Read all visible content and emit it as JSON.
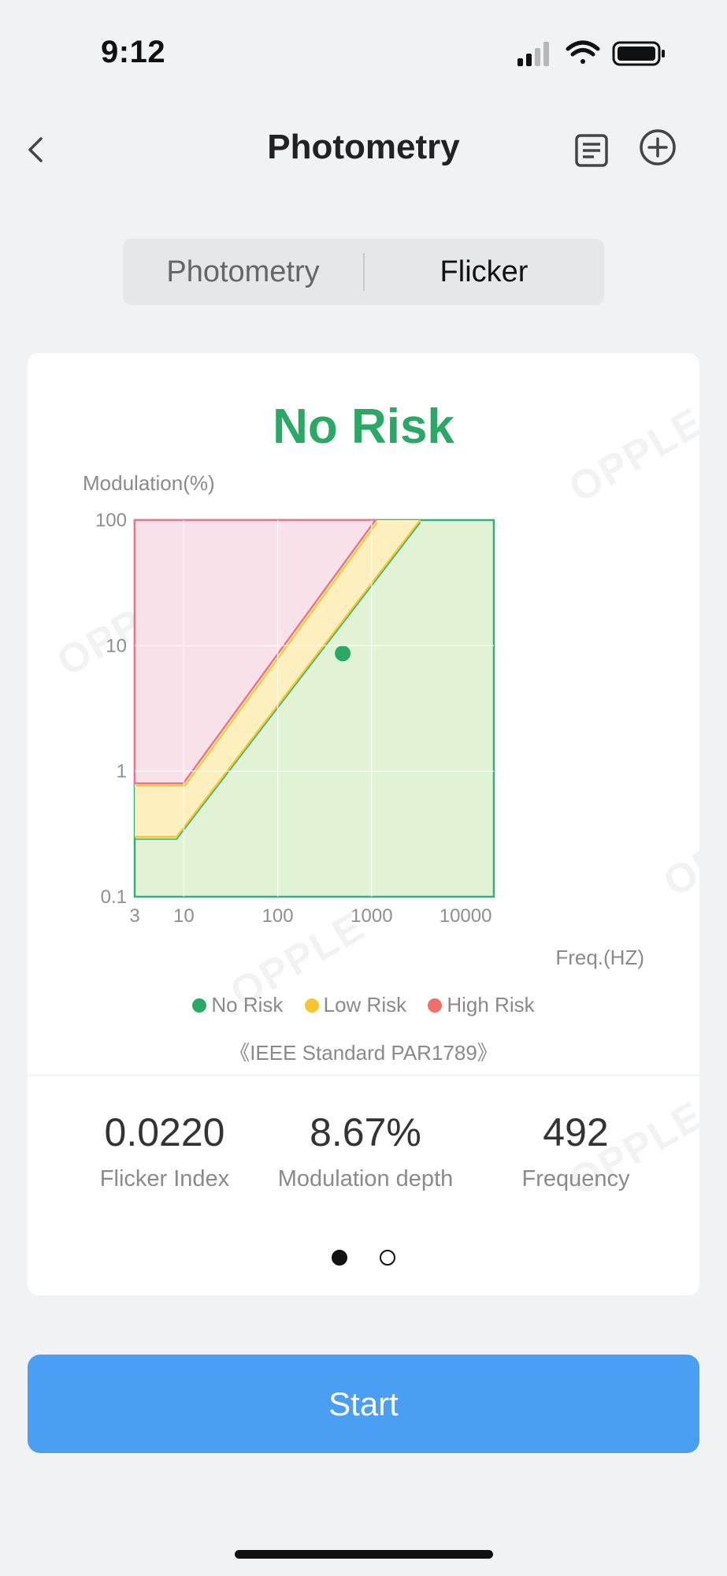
{
  "status_bar": {
    "time": "9:12",
    "icons": [
      "signal-icon",
      "wifi-icon",
      "battery-icon"
    ]
  },
  "nav": {
    "title": "Photometry",
    "back_icon": "chevron-left-icon",
    "doc_icon": "document-icon",
    "add_icon": "plus-circle-icon"
  },
  "tabs": [
    {
      "label": "Photometry",
      "selected": false
    },
    {
      "label": "Flicker",
      "selected": true
    }
  ],
  "result": {
    "title": "No Risk",
    "color": "#2aa866"
  },
  "watermark": "OPPLE",
  "chart_data": {
    "type": "area",
    "ylabel": "Modulation(%)",
    "xlabel": "Freq.(HZ)",
    "x_scale": "log",
    "y_scale": "log",
    "x_ticks": [
      "3",
      "10",
      "100",
      "1000",
      "10000"
    ],
    "y_ticks": [
      "100",
      "10",
      "1",
      "0.1"
    ],
    "xlim": [
      3,
      20000
    ],
    "ylim": [
      0.1,
      100
    ],
    "regions": [
      {
        "name": "High Risk",
        "color": "#e8748f",
        "fill": "#f9e1ea",
        "boundary": [
          [
            3,
            0.8
          ],
          [
            9.9,
            0.8
          ],
          [
            1100,
            100
          ]
        ]
      },
      {
        "name": "Low Risk",
        "color": "#f7c530",
        "fill": "#fdefbe",
        "boundary": [
          [
            3,
            0.3
          ],
          [
            8.4,
            0.3
          ],
          [
            3300,
            100
          ]
        ]
      },
      {
        "name": "No Risk",
        "color": "#34b17a",
        "fill": "#e1f2d5"
      }
    ],
    "point": {
      "x": 492,
      "y": 8.67,
      "color": "#2aa866"
    },
    "legend": [
      "No Risk",
      "Low Risk",
      "High Risk"
    ],
    "legend_colors": [
      "#2aa866",
      "#f7c530",
      "#ef6e6a"
    ],
    "legend_position": "bottom",
    "grid": true
  },
  "standard": "《IEEE Standard PAR1789》",
  "metrics": [
    {
      "value": "0.0220",
      "label": "Flicker Index"
    },
    {
      "value": "8.67%",
      "label": "Modulation depth"
    },
    {
      "value": "492",
      "label": "Frequency"
    }
  ],
  "pager": {
    "count": 2,
    "active": 0
  },
  "start_button": {
    "label": "Start",
    "color": "#4a9ff5"
  }
}
